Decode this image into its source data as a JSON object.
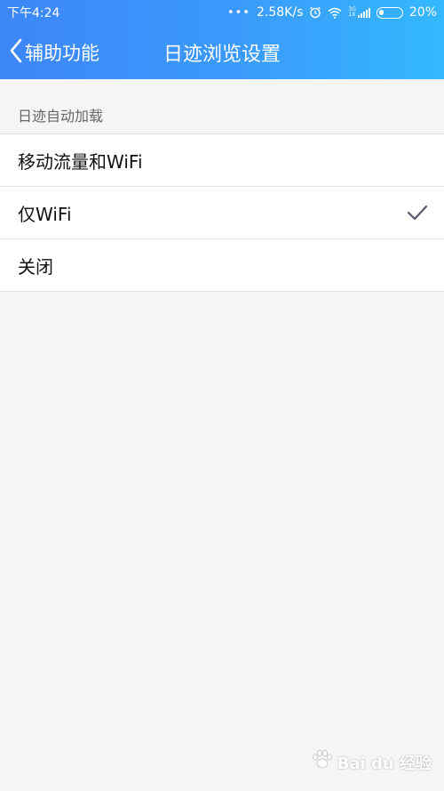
{
  "status_bar": {
    "time": "下午4:24",
    "dots": "•••",
    "network_speed": "2.58K/s",
    "signal_label_top": "3G",
    "signal_label_bottom": "1X",
    "battery_percent": "20%",
    "battery_level": 0.2,
    "icons": [
      "alarm-icon",
      "wifi-icon",
      "signal-icon",
      "battery-icon"
    ]
  },
  "nav": {
    "back_label": "辅助功能",
    "title": "日迹浏览设置"
  },
  "section": {
    "header": "日迹自动加载"
  },
  "options": [
    {
      "label": "移动流量和WiFi",
      "selected": false
    },
    {
      "label": "仅WiFi",
      "selected": true
    },
    {
      "label": "关闭",
      "selected": false
    }
  ],
  "watermark": {
    "text": "Bai du 经验"
  },
  "colors": {
    "header_start": "#3d86f8",
    "header_end": "#34b8ff",
    "background": "#f5f5f8",
    "checkmark": "#5a5a6e"
  }
}
